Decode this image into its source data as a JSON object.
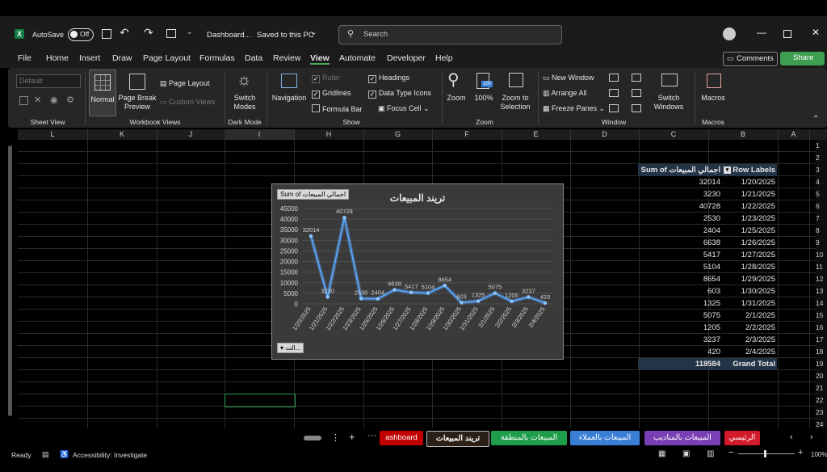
{
  "titlebar": {
    "autosave_label": "AutoSave",
    "autosave_state": "Off",
    "doc_title": "Dashboard...",
    "save_status": "Saved to this PC",
    "search_placeholder": "Search"
  },
  "menu": [
    "File",
    "Home",
    "Insert",
    "Draw",
    "Page Layout",
    "Formulas",
    "Data",
    "Review",
    "View",
    "Automate",
    "Developer",
    "Help"
  ],
  "menu_active": "View",
  "actions": {
    "comments": "Comments",
    "share": "Share"
  },
  "ribbon": {
    "sheet_view": {
      "dropdown": "Default",
      "group": "Sheet View"
    },
    "workbook_views": {
      "normal": "Normal",
      "page_break": "Page Break Preview",
      "page_layout": "Page Layout",
      "custom_views": "Custom Views",
      "group": "Workbook Views"
    },
    "dark_mode": {
      "switch": "Switch Modes",
      "group": "Dark Mode"
    },
    "show": {
      "navigation": "Navigation",
      "ruler": "Ruler",
      "gridlines": "Gridlines",
      "formula_bar": "Formula Bar",
      "headings": "Headings",
      "data_type_icons": "Data Type Icons",
      "focus_cell": "Focus Cell",
      "group": "Show"
    },
    "zoom": {
      "zoom": "Zoom",
      "hundred": "100%",
      "zoom_sel": "Zoom to Selection",
      "group": "Zoom"
    },
    "window": {
      "new_window": "New Window",
      "arrange_all": "Arrange All",
      "freeze_panes": "Freeze Panes",
      "switch_windows": "Switch Windows",
      "group": "Window"
    },
    "macros": {
      "macros": "Macros",
      "group": "Macros"
    }
  },
  "columns": [
    "L",
    "K",
    "J",
    "I",
    "H",
    "G",
    "F",
    "E",
    "D",
    "C",
    "B",
    "A"
  ],
  "rows": [
    "1",
    "2",
    "3",
    "4",
    "5",
    "6",
    "7",
    "8",
    "9",
    "10",
    "11",
    "12",
    "13",
    "14",
    "15",
    "16",
    "17",
    "18",
    "19",
    "20",
    "21",
    "22",
    "23",
    "24"
  ],
  "pivot": {
    "header_values": "Sum of اجمالي المبيعات",
    "header_labels": "Row Labels",
    "rows": [
      {
        "label": "1/20/2025",
        "value": "32014"
      },
      {
        "label": "1/21/2025",
        "value": "3230"
      },
      {
        "label": "1/22/2025",
        "value": "40728"
      },
      {
        "label": "1/23/2025",
        "value": "2530"
      },
      {
        "label": "1/25/2025",
        "value": "2404"
      },
      {
        "label": "1/26/2025",
        "value": "6638"
      },
      {
        "label": "1/27/2025",
        "value": "5417"
      },
      {
        "label": "1/28/2025",
        "value": "5104"
      },
      {
        "label": "1/29/2025",
        "value": "8654"
      },
      {
        "label": "1/30/2025",
        "value": "603"
      },
      {
        "label": "1/31/2025",
        "value": "1325"
      },
      {
        "label": "2/1/2025",
        "value": "5075"
      },
      {
        "label": "2/2/2025",
        "value": "1205"
      },
      {
        "label": "2/3/2025",
        "value": "3237"
      },
      {
        "label": "2/4/2025",
        "value": "420"
      }
    ],
    "grand_total_label": "Grand Total",
    "grand_total_value": "118584"
  },
  "chart_data": {
    "type": "line",
    "title": "تريند المبيعات",
    "field_button": "Sum of اجمالي المبيعات",
    "axis_button": "الت...",
    "categories": [
      "1/20/2025",
      "1/21/2025",
      "1/22/2025",
      "1/23/2025",
      "1/25/2025",
      "1/26/2025",
      "1/27/2025",
      "1/28/2025",
      "1/29/2025",
      "1/30/2025",
      "1/31/2025",
      "2/1/2025",
      "2/2/2025",
      "2/3/2025",
      "2/4/2025"
    ],
    "values": [
      32014,
      3230,
      40728,
      2530,
      2404,
      6638,
      5417,
      5104,
      8654,
      603,
      1325,
      5075,
      1205,
      3237,
      420
    ],
    "yticks": [
      0,
      5000,
      10000,
      15000,
      20000,
      25000,
      30000,
      35000,
      40000,
      45000
    ],
    "ylim": [
      0,
      45000
    ],
    "grid": true,
    "line_color": "#5aa8ff"
  },
  "sheet_tabs": [
    {
      "label": "ashboard",
      "color": "#c00000"
    },
    {
      "label": "تريند المبيعات",
      "color": "#3a2a1a",
      "active": true
    },
    {
      "label": "المبيعات بالمنطقة",
      "color": "#1e9e4a"
    },
    {
      "label": "المبيعات بالعملاء",
      "color": "#3a7fd5"
    },
    {
      "label": "المبيعات بالمناديب",
      "color": "#7a3fb5"
    },
    {
      "label": "الرئيسي",
      "color": "#d11a2a"
    }
  ],
  "status": {
    "ready": "Ready",
    "accessibility": "Accessibility: Investigate",
    "zoom": "100%"
  }
}
